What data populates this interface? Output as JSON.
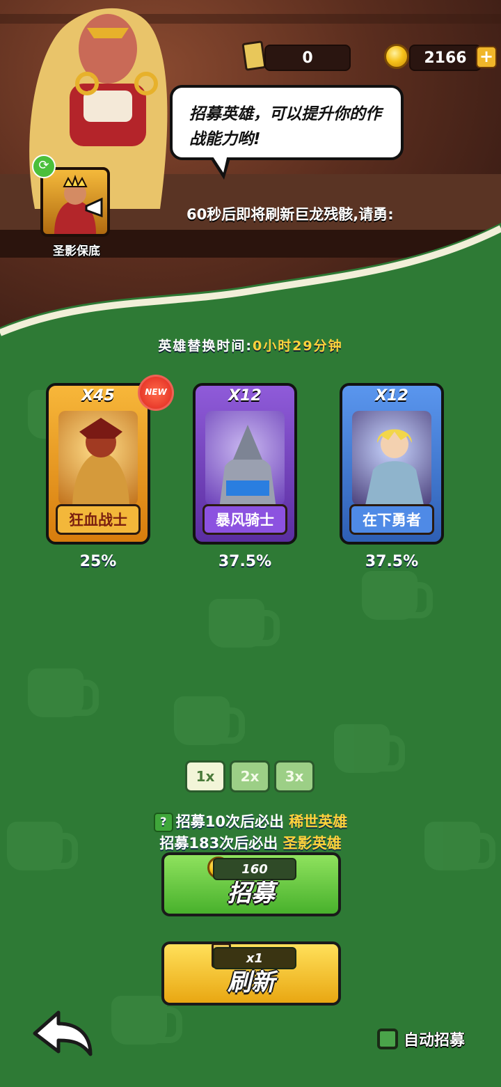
{
  "hud": {
    "hourglass_count": "0",
    "gold_count": "2166",
    "add_icon": "plus-icon"
  },
  "npc": {
    "speech": "招募英雄，可以提升你的作战能力哟!",
    "ticker": "60秒后即将刷新巨龙残骸,请勇:"
  },
  "guarantee": {
    "label": "圣影保底"
  },
  "timer": {
    "prefix": "英雄替换时间:",
    "value": "0小时29分钟"
  },
  "cards": [
    {
      "multiplier": "X45",
      "name": "狂血战士",
      "percent": "25%",
      "badge": "NEW",
      "color": "#f2a72c"
    },
    {
      "multiplier": "X12",
      "name": "暴风骑士",
      "percent": "37.5%",
      "color": "#8a4fd4"
    },
    {
      "multiplier": "X12",
      "name": "在下勇者",
      "percent": "37.5%",
      "color": "#4c8ae6"
    }
  ],
  "multipliers": [
    "1x",
    "2x",
    "3x"
  ],
  "selected_multiplier": "1x",
  "pity": {
    "line1_prefix": "招募10次后必出",
    "line1_highlight": "稀世英雄",
    "line2_prefix": "招募183次后必出",
    "line2_highlight": "圣影英雄",
    "help_icon": "?"
  },
  "recruit_button": {
    "cost": "160",
    "label": "招募"
  },
  "refresh_button": {
    "cost": "x1",
    "label": "刷新"
  },
  "auto_recruit": {
    "label": "自动招募",
    "checked": false
  }
}
